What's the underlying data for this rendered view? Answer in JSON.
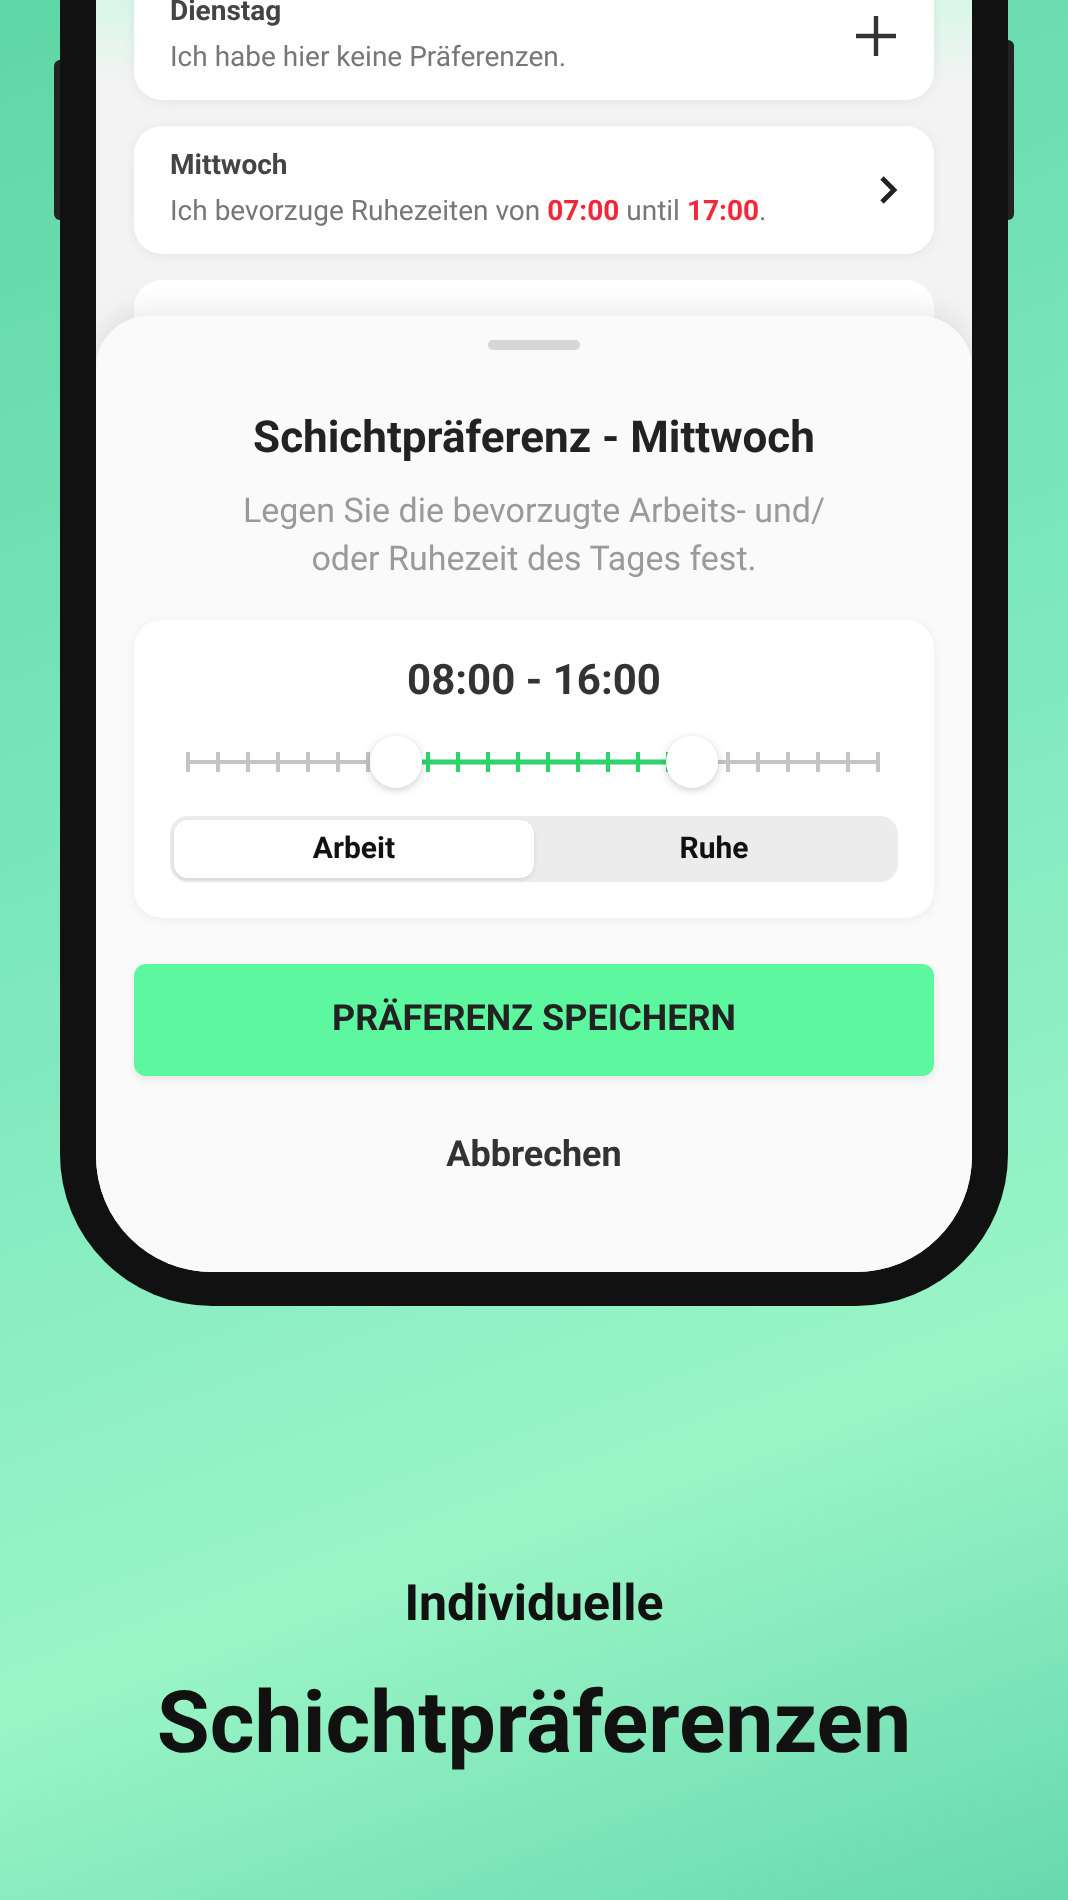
{
  "days": [
    {
      "name": "Dienstag",
      "summary": "Ich habe hier keine Präferenzen.",
      "kind": "add"
    },
    {
      "name": "Mittwoch",
      "summary": "Ich bevorzuge Ruhezeiten von **07:00** until **17:00**.",
      "kind": "open"
    }
  ],
  "sheet": {
    "title": "Schichtpräferenz - Mittwoch",
    "subtitle": "Legen Sie die bevorzugte Arbeits- und/ oder Ruhezeit des Tages fest.",
    "range_label": "08:00 - 16:00",
    "thumbs": [
      {
        "level": 0.3
      },
      {
        "level": 0.73
      }
    ],
    "modes": [
      {
        "label": "Arbeit",
        "selected": true
      },
      {
        "label": "Ruhe",
        "selected": false
      }
    ],
    "save_button": "PRÄFERENZ SPEICHERN",
    "cancel_button": "Abbrechen"
  },
  "caption": {
    "line1": "Individuelle",
    "line2": "Schichtpräferenzen"
  }
}
